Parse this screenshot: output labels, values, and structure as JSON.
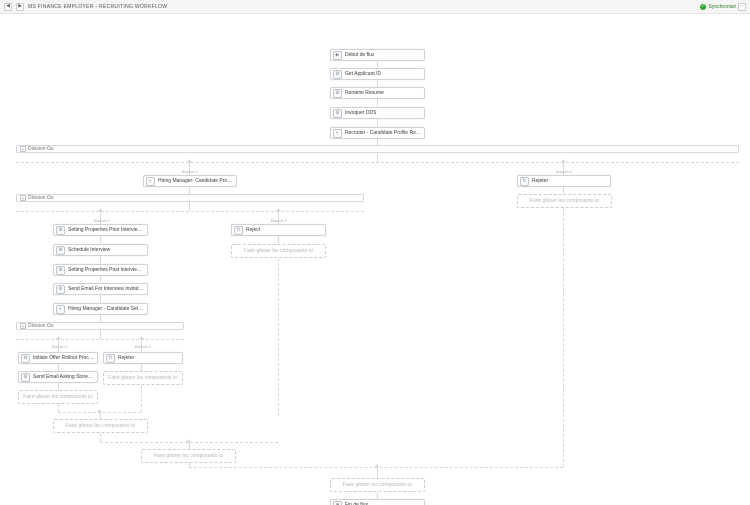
{
  "header": {
    "title": "MS FINANCE EMPLOYER - RECRUITING WORKFLOW",
    "sync_label": "Synchronisé"
  },
  "blocks": {
    "start": "Début de flux",
    "get_applicant": "Get Applicant ID",
    "rename_resume": "Rename Resume",
    "invoquer_dds": "Invoquer DDS",
    "recruiter_review": "Recruiter - Candidate Profile Review",
    "hiring_mgr_review": "Hiring Manager- Candidate Profile Revi...",
    "rejeter": "Rejeter",
    "set_props_prior": "Setting Properties Prior Interview Schec...",
    "reject2": "Reject",
    "schedule_interview": "Schedule Interview",
    "set_props_post": "Setting Properties Post Interview Schec...",
    "send_email_inv": "Send Email For Interview Invitation",
    "hiring_mgr_sel": "Hiring Manager - Candidate Selection",
    "initiate_offer": "Initiate Offer Rollout Process",
    "rejeter2": "Rejeter",
    "send_email_store": "Send Email Asking Store Data...",
    "end": "Fin de flux"
  },
  "splits": {
    "s1": "Division Ou",
    "s2": "Division Ou",
    "s3": "Division Ou"
  },
  "branches": {
    "b1": "Branch 1",
    "b2": "Branch 2"
  },
  "drop": "Faire glisser les composants ici"
}
